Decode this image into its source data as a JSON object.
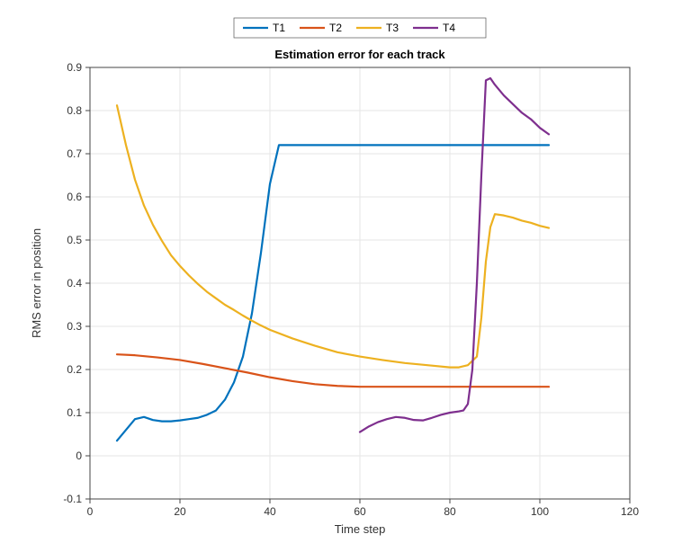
{
  "chart_data": {
    "type": "line",
    "title": "Estimation error for each track",
    "xlabel": "Time step",
    "ylabel": "RMS error in position",
    "xlim": [
      0,
      120
    ],
    "ylim": [
      -0.1,
      0.9
    ],
    "xticks": [
      0,
      20,
      40,
      60,
      80,
      100,
      120
    ],
    "yticks": [
      -0.1,
      0,
      0.1,
      0.2,
      0.3,
      0.4,
      0.5,
      0.6,
      0.7,
      0.8,
      0.9
    ],
    "legend_position": "top-outside",
    "series": [
      {
        "name": "T1",
        "color": "#0072BD",
        "x": [
          6,
          8,
          10,
          12,
          14,
          16,
          18,
          20,
          22,
          24,
          26,
          28,
          30,
          32,
          34,
          36,
          38,
          40,
          42,
          44,
          46,
          48,
          50,
          60,
          70,
          80,
          90,
          100,
          102
        ],
        "y": [
          0.035,
          0.06,
          0.085,
          0.09,
          0.083,
          0.08,
          0.08,
          0.082,
          0.085,
          0.088,
          0.095,
          0.105,
          0.13,
          0.17,
          0.23,
          0.33,
          0.47,
          0.63,
          0.72,
          0.72,
          0.72,
          0.72,
          0.72,
          0.72,
          0.72,
          0.72,
          0.72,
          0.72,
          0.72
        ]
      },
      {
        "name": "T2",
        "color": "#D95319",
        "x": [
          6,
          10,
          15,
          20,
          25,
          30,
          35,
          40,
          45,
          50,
          55,
          60,
          70,
          80,
          90,
          100,
          102
        ],
        "y": [
          0.235,
          0.233,
          0.228,
          0.222,
          0.213,
          0.203,
          0.193,
          0.182,
          0.173,
          0.166,
          0.162,
          0.16,
          0.16,
          0.16,
          0.16,
          0.16,
          0.16
        ]
      },
      {
        "name": "T3",
        "color": "#EDB120",
        "x": [
          6,
          8,
          10,
          12,
          14,
          16,
          18,
          20,
          22,
          24,
          26,
          28,
          30,
          32,
          34,
          36,
          38,
          40,
          45,
          50,
          55,
          60,
          65,
          70,
          75,
          80,
          82,
          84,
          86,
          87,
          88,
          89,
          90,
          92,
          94,
          96,
          98,
          100,
          102
        ],
        "y": [
          0.812,
          0.72,
          0.64,
          0.58,
          0.535,
          0.498,
          0.465,
          0.44,
          0.418,
          0.398,
          0.38,
          0.365,
          0.35,
          0.338,
          0.325,
          0.313,
          0.302,
          0.292,
          0.272,
          0.255,
          0.24,
          0.23,
          0.222,
          0.215,
          0.21,
          0.205,
          0.205,
          0.21,
          0.23,
          0.32,
          0.45,
          0.53,
          0.56,
          0.557,
          0.552,
          0.545,
          0.54,
          0.533,
          0.528
        ]
      },
      {
        "name": "T4",
        "color": "#7E2F8E",
        "x": [
          60,
          62,
          64,
          66,
          68,
          70,
          72,
          74,
          76,
          78,
          80,
          82,
          83,
          84,
          85,
          86,
          87,
          88,
          89,
          90,
          92,
          94,
          96,
          98,
          100,
          102
        ],
        "y": [
          0.055,
          0.068,
          0.078,
          0.085,
          0.09,
          0.088,
          0.083,
          0.082,
          0.088,
          0.095,
          0.1,
          0.103,
          0.105,
          0.12,
          0.2,
          0.4,
          0.65,
          0.87,
          0.875,
          0.86,
          0.835,
          0.815,
          0.795,
          0.78,
          0.76,
          0.745
        ]
      }
    ]
  },
  "legend": {
    "items": [
      "T1",
      "T2",
      "T3",
      "T4"
    ]
  }
}
